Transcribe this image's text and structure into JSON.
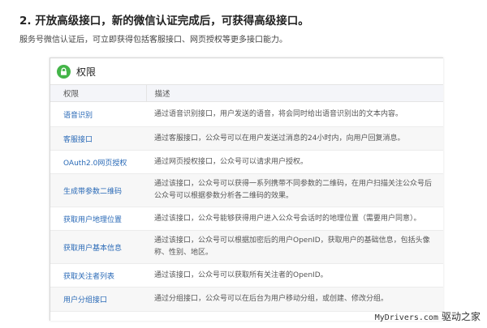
{
  "heading": "2. 开放高级接口，新的微信认证完成后，可获得高级接口。",
  "intro": "服务号微信认证后，可立即获得包括客服接口、网页授权等更多接口能力。",
  "panel": {
    "title": "权限",
    "columns": [
      "权限",
      "描述"
    ],
    "rows": [
      {
        "name": "语音识别",
        "desc": [
          "通过语音识别接口，用户发送的语音，将会同时给出语音识别出的文本内容。"
        ]
      },
      {
        "name": "客服接口",
        "desc": [
          "通过客服接口，公众号可以在用户发送过消息的24小时内，向用户回复消息。"
        ]
      },
      {
        "name": "OAuth2.0网页授权",
        "desc": [
          "通过网页授权接口，公众号可以请求用户授权。"
        ]
      },
      {
        "name": "生成带参数二维码",
        "desc": [
          "通过该接口，公众号可以获得一系列携带不同参数的二维码，在用户扫描关注公众号后",
          "公众号可以根据参数分析各二维码的效果。"
        ]
      },
      {
        "name": "获取用户地理位置",
        "desc": [
          "通过该接口，公众号能够获得用户进入公众号会话时的地理位置（需要用户同意）。"
        ]
      },
      {
        "name": "获取用户基本信息",
        "desc": [
          "通过该接口，公众号可以根据加密后的用户OpenID，获取用户的基础信息，包括头像",
          "称、性别、地区。"
        ]
      },
      {
        "name": "获取关注者列表",
        "desc": [
          "通过该接口，公众号可以获取所有关注者的OpenID。"
        ]
      },
      {
        "name": "用户分组接口",
        "desc": [
          "通过分组接口，公众号可以在后台为用户移动分组，或创建、修改分组。"
        ]
      }
    ]
  },
  "watermark": {
    "site": "MyDrivers.com",
    "cn": "驱动之家"
  },
  "colors": {
    "accent_green": "#44b549",
    "link_blue": "#2a6ab7"
  },
  "icons": {
    "panel_icon": "lock-icon"
  }
}
